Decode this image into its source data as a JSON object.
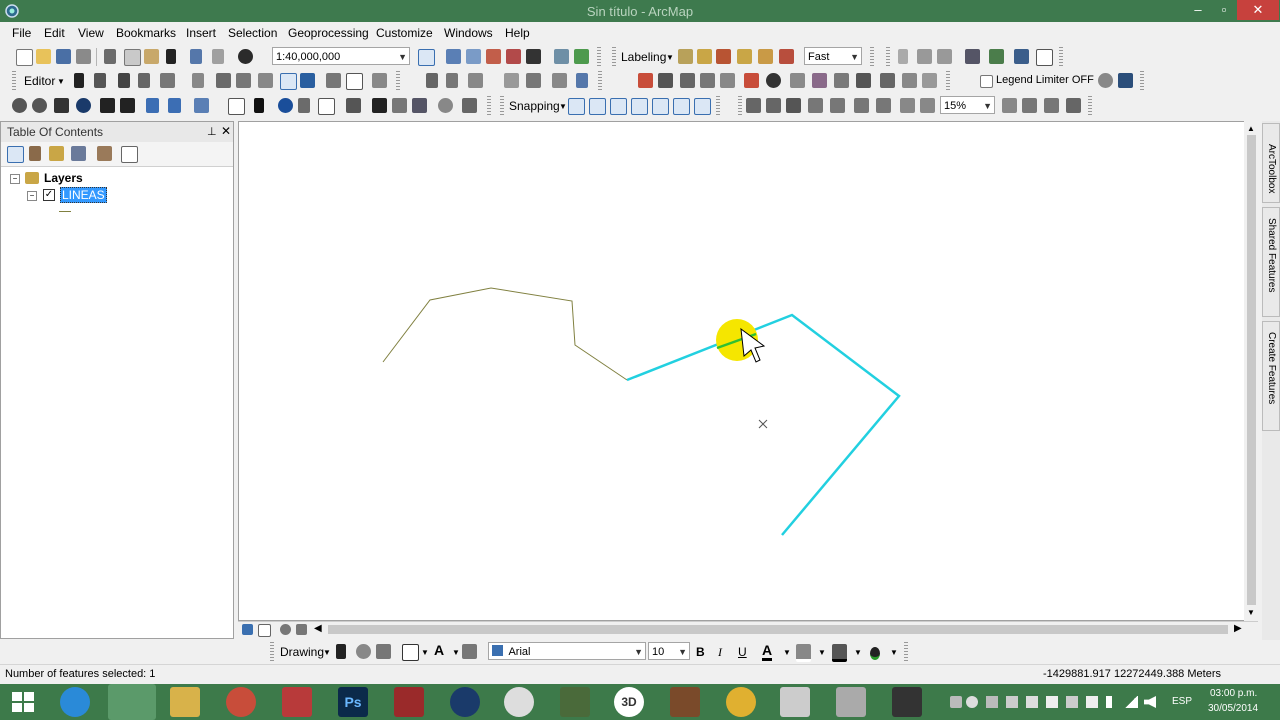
{
  "window": {
    "title": "Sin título - ArcMap",
    "minimize": "–",
    "maximize": "▫",
    "close": "✕"
  },
  "menu": [
    "File",
    "Edit",
    "View",
    "Bookmarks",
    "Insert",
    "Selection",
    "Geoprocessing",
    "Customize",
    "Windows",
    "Help"
  ],
  "toolbar": {
    "scale_value": "1:40,000,000",
    "labeling_label": "Labeling",
    "labeling_quality": "Fast",
    "editor_label": "Editor",
    "legend_limiter_label": "Legend Limiter OFF",
    "snapping_label": "Snapping",
    "zoom_value": "15%"
  },
  "toc": {
    "title": "Table Of Contents",
    "pin_icon": "pin-icon",
    "close_icon": "close-icon",
    "group_label": "Layers",
    "layer_name": "LINEAS"
  },
  "right_dock": {
    "tabs": [
      "ArcToolbox",
      "Shared Features",
      "Create Features"
    ]
  },
  "drawing": {
    "label": "Drawing",
    "font_name": "Arial",
    "font_size": "10",
    "bold": "B",
    "italic": "I",
    "underline": "U",
    "text_tool": "A",
    "font_color_label": "A"
  },
  "status": {
    "selected_count": "Number of features selected: 1",
    "coordinates": "-1429881.917  12272449.388 Meters"
  },
  "system_tray": {
    "language": "ESP",
    "time": "03:00 p.m.",
    "date": "30/05/2014"
  },
  "colors": {
    "title_bar": "#3e7a4e",
    "taskbar": "#3d7a4a",
    "unselected_line": "#808040",
    "selected_line": "#22d0e0",
    "cursor_highlight": "#f5e600"
  }
}
